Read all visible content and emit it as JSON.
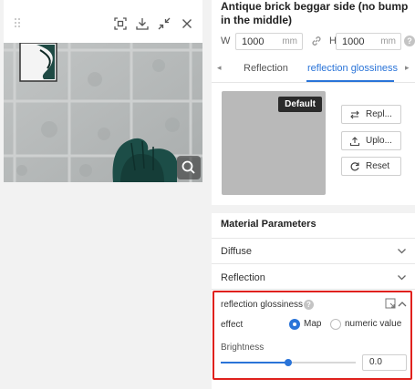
{
  "preview": {
    "toolbar_icons": [
      "drag-handle-icon",
      "focus-frame-icon",
      "download-icon",
      "collapse-arrows-icon",
      "close-icon"
    ],
    "zoom_icon": "magnifier-icon"
  },
  "material": {
    "title": "Antique brick beggar side (no bump in the middle)",
    "width_label": "W",
    "width_value": "1000",
    "width_unit": "mm",
    "height_label": "H",
    "height_value": "1000",
    "height_unit": "mm",
    "help_glyph": "?"
  },
  "tabs": {
    "items": [
      {
        "label": "Reflection",
        "active": false
      },
      {
        "label": "reflection glossiness",
        "active": true
      }
    ],
    "prev_arrow": "◂",
    "next_arrow": "▸"
  },
  "map_card": {
    "badge": "Default",
    "replace_label": "Repl...",
    "upload_label": "Uplo...",
    "reset_label": "Reset"
  },
  "params": {
    "heading": "Material Parameters",
    "rows": [
      {
        "label": "Diffuse",
        "expanded": false
      },
      {
        "label": "Reflection",
        "expanded": false
      }
    ],
    "glossiness": {
      "title": "reflection glossiness",
      "help_glyph": "?",
      "effect_label": "effect",
      "options": [
        {
          "label": "Map",
          "selected": true
        },
        {
          "label": "numeric value",
          "selected": false
        }
      ],
      "brightness_label": "Brightness",
      "brightness_level": 0.5,
      "value": "0.0"
    }
  },
  "colors": {
    "accent": "#2a74d8",
    "highlight": "#e0211d",
    "badge_bg": "#2b2b2b"
  }
}
